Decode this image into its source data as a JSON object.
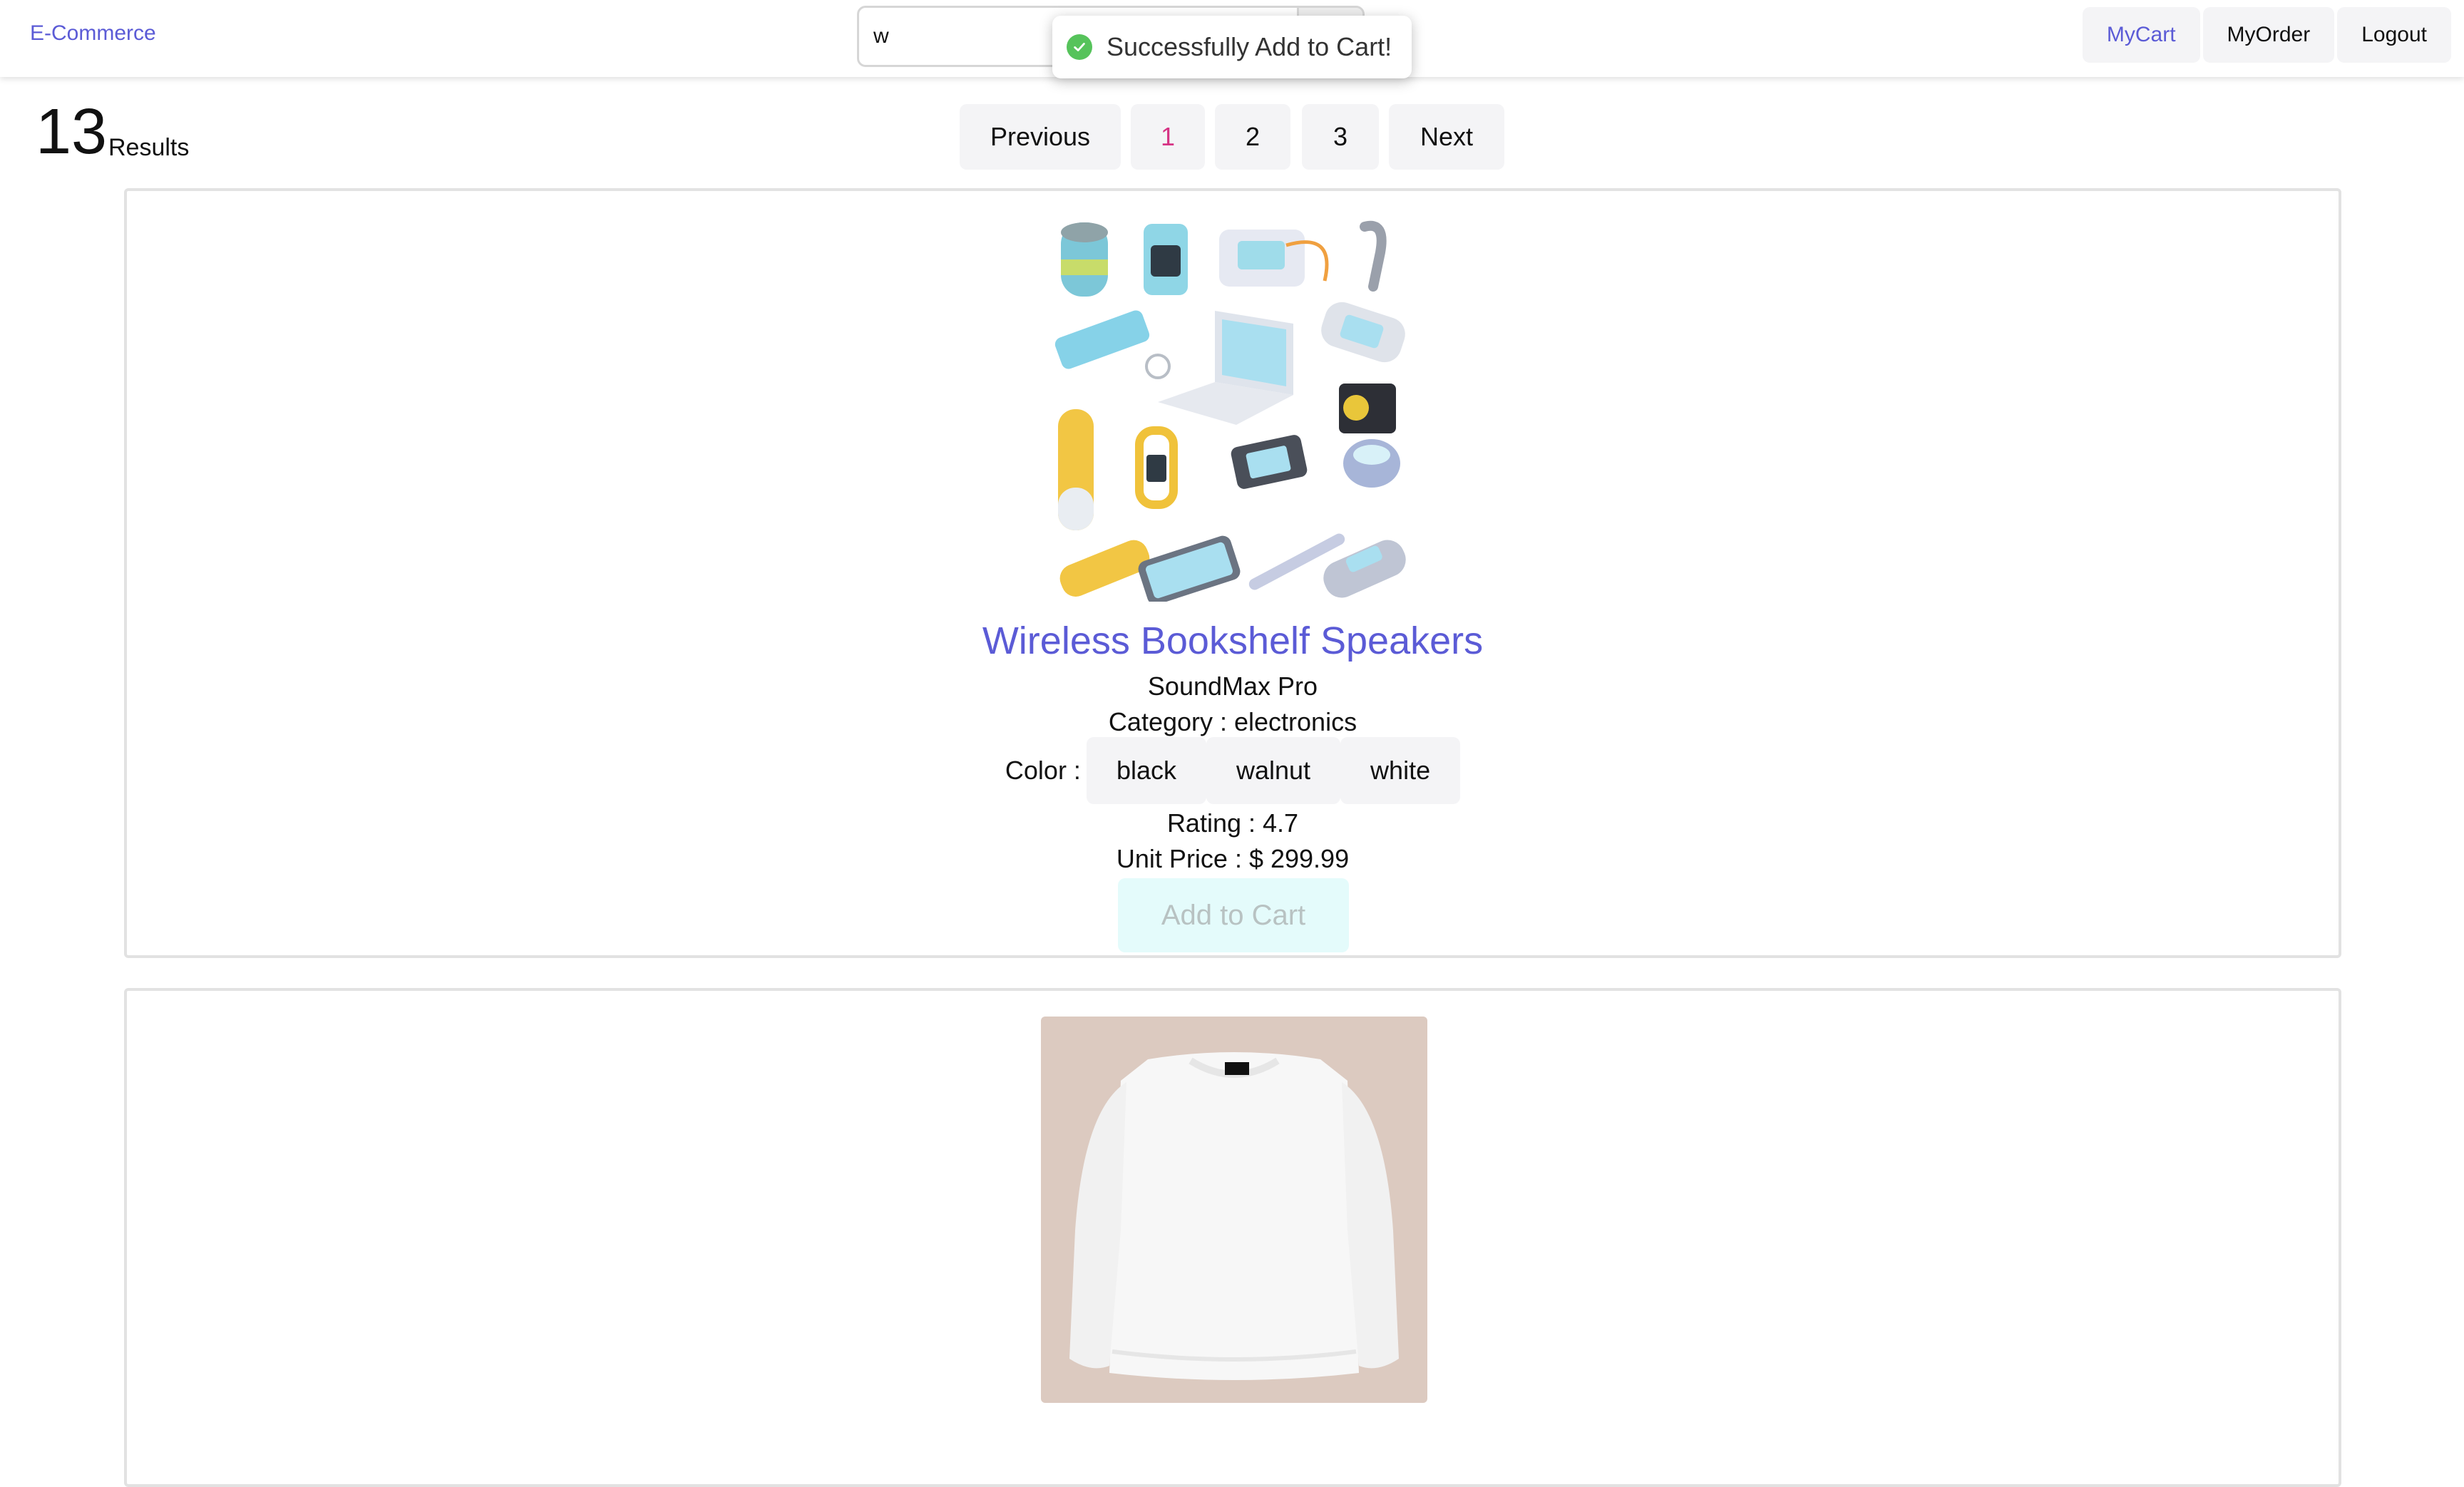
{
  "nav": {
    "brand": "E-Commerce",
    "search_value": "w",
    "links": [
      "MyCart",
      "MyOrder",
      "Logout"
    ]
  },
  "toast": {
    "message": "Successfully Add to Cart!"
  },
  "results": {
    "count": "13",
    "label": "Results"
  },
  "pagination": {
    "previous": "Previous",
    "pages": [
      "1",
      "2",
      "3"
    ],
    "current_page": "1",
    "next": "Next"
  },
  "products": [
    {
      "name": "Wireless Bookshelf Speakers",
      "brand": "SoundMax Pro",
      "category": "Category : electronics",
      "color_label": "Color :",
      "colors": [
        "black",
        "walnut",
        "white"
      ],
      "rating": "Rating : 4.7",
      "price": "Unit Price : $ 299.99",
      "add_to_cart": "Add to Cart"
    }
  ],
  "colors": {
    "accent": "#5b5bd6",
    "current_page": "#d63384",
    "toast_icon": "#56c35b",
    "add_to_cart_bg": "#e4fbfb"
  }
}
